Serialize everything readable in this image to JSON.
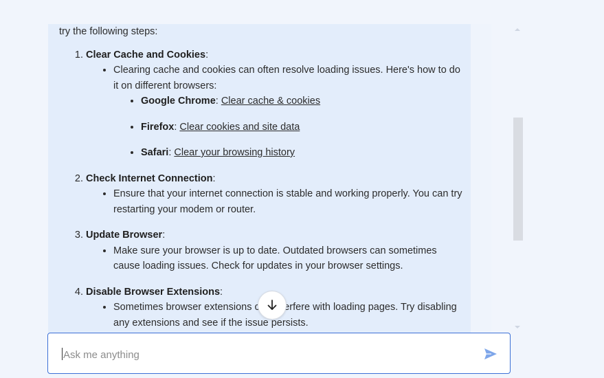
{
  "message": {
    "intro": "try the following steps:",
    "steps": [
      {
        "title": "Clear Cache and Cookies",
        "bullet": "Clearing cache and cookies can often resolve loading issues. Here's how to do it on different browsers:",
        "browsers": [
          {
            "name": "Google Chrome",
            "link": "Clear cache & cookies"
          },
          {
            "name": "Firefox",
            "link": "Clear cookies and site data"
          },
          {
            "name": "Safari",
            "link": "Clear your browsing history"
          }
        ]
      },
      {
        "title": "Check Internet Connection",
        "bullet": "Ensure that your internet connection is stable and working properly. You can try restarting your modem or router."
      },
      {
        "title": "Update Browser",
        "bullet": "Make sure your browser is up to date. Outdated browsers can sometimes cause loading issues. Check for updates in your browser settings."
      },
      {
        "title": "Disable Browser Extensions",
        "bullet": "Sometimes browser extensions can interfere with loading pages. Try disabling any extensions and see if the issue persists."
      }
    ]
  },
  "composer": {
    "placeholder": "Ask me anything"
  },
  "icons": {
    "scroll_down": "arrow-down-icon",
    "send": "send-icon"
  },
  "colors": {
    "panel_bg": "#e3edfb",
    "accent": "#3b6fd6",
    "send_icon": "#7ea6ea"
  }
}
